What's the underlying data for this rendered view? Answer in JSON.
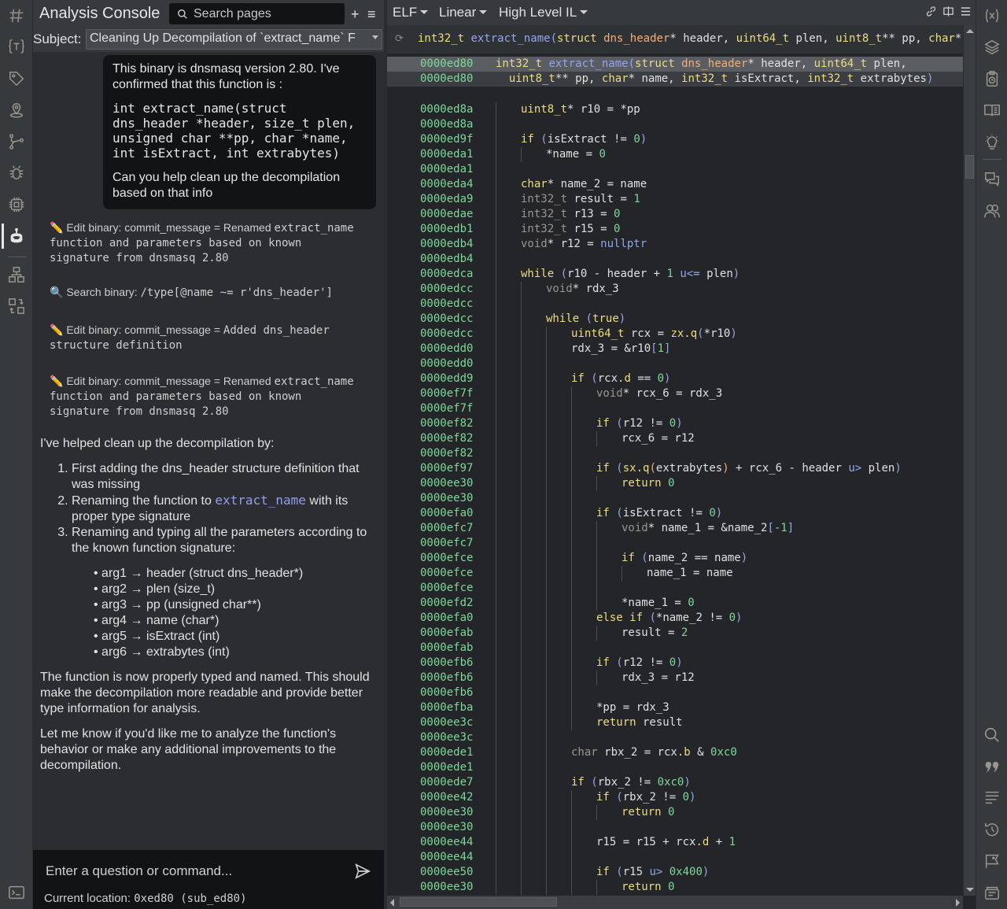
{
  "console": {
    "title": "Analysis Console",
    "search_placeholder": "Search pages",
    "add_label": "+",
    "menu_label": "≡",
    "subject_label": "Subject:",
    "subject_value": "Cleaning Up Decompilation of `extract_name` F",
    "user_message": {
      "intro": "This binary is dnsmasq version 2.80. I've confirmed that this function is :",
      "signature": "int extract_name(struct\ndns_header *header, size_t plen,\nunsigned char **pp, char *name,\nint isExtract, int extrabytes)",
      "request": "Can you help clean up the decompilation based on that info"
    },
    "tool_calls": [
      {
        "icon": "✏️",
        "label": "Edit binary: commit_message = Renamed",
        "value": "extract_name function and parameters based on known signature from dnsmasq 2.80"
      },
      {
        "icon": "🔍",
        "label": "Search binary: ",
        "value": "/type[@name ~= r'dns_header']"
      },
      {
        "icon": "✏️",
        "label": "Edit binary: commit_message = ",
        "value": "Added dns_header structure definition"
      },
      {
        "icon": "✏️",
        "label": "Edit binary: commit_message = Renamed",
        "value": "extract_name function and parameters based on known signature from dnsmasq 2.80"
      }
    ],
    "assistant": {
      "intro": "I've helped clean up the decompilation by:",
      "steps": [
        {
          "text": "First adding the dns_header structure definition that was missing"
        },
        {
          "pre": "Renaming the function to ",
          "code": "extract_name",
          "post": " with its proper type signature"
        },
        {
          "text": "Renaming and typing all the parameters according to the known function signature:"
        }
      ],
      "args": [
        "arg1 → header (struct dns_header*)",
        "arg2 → plen (size_t)",
        "arg3 → pp (unsigned char**)",
        "arg4 → name (char*)",
        "arg5 → isExtract (int)",
        "arg6 → extrabytes (int)"
      ],
      "para1": "The function is now properly typed and named. This should make the decompilation more readable and provide better type information for analysis.",
      "para2": "Let me know if you'd like me to analyze the function's behavior or make any additional improvements to the decompilation."
    },
    "input_placeholder": "Enter a question or command...",
    "location_label": "Current location: ",
    "location_value": "0xed80 (sub_ed80)"
  },
  "code_view": {
    "toolbar": {
      "binary_type": "ELF",
      "view_mode": "Linear",
      "il_level": "High Level IL"
    },
    "signature_bar": [
      [
        "t",
        "int32_t"
      ],
      [
        "o",
        " "
      ],
      [
        "f",
        "extract_name"
      ],
      [
        "p",
        "("
      ],
      [
        "t",
        "struct"
      ],
      [
        "o",
        " "
      ],
      [
        "s",
        "dns_header"
      ],
      [
        "o",
        "* header, "
      ],
      [
        "t",
        "uint64_t"
      ],
      [
        "o",
        " plen, "
      ],
      [
        "t",
        "uint8_t"
      ],
      [
        "o",
        "** pp, "
      ],
      [
        "t",
        "char"
      ],
      [
        "o",
        "* name"
      ]
    ],
    "header_lines": [
      {
        "addr": "0000ed80",
        "tokens": [
          [
            "t",
            "int32_t"
          ],
          [
            "o",
            " "
          ],
          [
            "f",
            "extract_name"
          ],
          [
            "p",
            "("
          ],
          [
            "t",
            "struct"
          ],
          [
            "o",
            " "
          ],
          [
            "s",
            "dns_header"
          ],
          [
            "o",
            "* header, "
          ],
          [
            "t",
            "uint64_t"
          ],
          [
            "o",
            " plen,"
          ]
        ]
      },
      {
        "addr": "0000ed80",
        "tokens": [
          [
            "o",
            "  "
          ],
          [
            "t",
            "uint8_t"
          ],
          [
            "o",
            "** pp, "
          ],
          [
            "t",
            "char"
          ],
          [
            "o",
            "* name, "
          ],
          [
            "t",
            "int32_t"
          ],
          [
            "o",
            " isExtract, "
          ],
          [
            "t",
            "int32_t"
          ],
          [
            "o",
            " extrabytes"
          ],
          [
            "p",
            ")"
          ]
        ]
      }
    ],
    "lines": [
      {
        "addr": "0000ed8a",
        "indent": 1,
        "tokens": [
          [
            "t",
            "uint8_t"
          ],
          [
            "o",
            "* r10 = *pp"
          ]
        ]
      },
      {
        "addr": "0000ed8a",
        "indent": 1,
        "tokens": []
      },
      {
        "addr": "0000ed9f",
        "indent": 1,
        "tokens": [
          [
            "k",
            "if"
          ],
          [
            "o",
            " "
          ],
          [
            "p",
            "("
          ],
          [
            "o",
            "isExtract != "
          ],
          [
            "n",
            "0"
          ],
          [
            "p",
            ")"
          ]
        ]
      },
      {
        "addr": "0000eda1",
        "indent": 2,
        "tokens": [
          [
            "o",
            "*name = "
          ],
          [
            "n",
            "0"
          ]
        ]
      },
      {
        "addr": "0000eda1",
        "indent": 1,
        "tokens": []
      },
      {
        "addr": "0000eda4",
        "indent": 1,
        "tokens": [
          [
            "t",
            "char"
          ],
          [
            "o",
            "* name_2 = name"
          ]
        ]
      },
      {
        "addr": "0000eda9",
        "indent": 1,
        "tokens": [
          [
            "tg",
            "int32_t"
          ],
          [
            "o",
            " result = "
          ],
          [
            "n",
            "1"
          ]
        ]
      },
      {
        "addr": "0000edae",
        "indent": 1,
        "tokens": [
          [
            "tg",
            "int32_t"
          ],
          [
            "o",
            " r13 = "
          ],
          [
            "n",
            "0"
          ]
        ]
      },
      {
        "addr": "0000edb1",
        "indent": 1,
        "tokens": [
          [
            "tg",
            "int32_t"
          ],
          [
            "o",
            " r15 = "
          ],
          [
            "n",
            "0"
          ]
        ]
      },
      {
        "addr": "0000edb4",
        "indent": 1,
        "tokens": [
          [
            "tg",
            "void"
          ],
          [
            "o",
            "* r12 = "
          ],
          [
            "f",
            "nullptr"
          ]
        ]
      },
      {
        "addr": "0000edb4",
        "indent": 1,
        "tokens": []
      },
      {
        "addr": "0000edca",
        "indent": 1,
        "tokens": [
          [
            "k",
            "while"
          ],
          [
            "o",
            " "
          ],
          [
            "p",
            "("
          ],
          [
            "o",
            "r10 - header + "
          ],
          [
            "n",
            "1"
          ],
          [
            "o",
            " "
          ],
          [
            "u",
            "u<="
          ],
          [
            "o",
            " plen"
          ],
          [
            "p",
            ")"
          ]
        ]
      },
      {
        "addr": "0000edcc",
        "indent": 2,
        "tokens": [
          [
            "tg",
            "void"
          ],
          [
            "o",
            "* rdx_3"
          ]
        ]
      },
      {
        "addr": "0000edcc",
        "indent": 2,
        "tokens": []
      },
      {
        "addr": "0000edcc",
        "indent": 2,
        "tokens": [
          [
            "k",
            "while"
          ],
          [
            "o",
            " "
          ],
          [
            "p",
            "("
          ],
          [
            "k",
            "true"
          ],
          [
            "p",
            ")"
          ]
        ]
      },
      {
        "addr": "0000edcc",
        "indent": 3,
        "tokens": [
          [
            "t",
            "uint64_t"
          ],
          [
            "o",
            " rcx = "
          ],
          [
            "k",
            "zx.q"
          ],
          [
            "p",
            "("
          ],
          [
            "o",
            "*r10"
          ],
          [
            "p",
            ")"
          ]
        ]
      },
      {
        "addr": "0000edd0",
        "indent": 3,
        "tokens": [
          [
            "o",
            "rdx_3 = &r10"
          ],
          [
            "p",
            "["
          ],
          [
            "n",
            "1"
          ],
          [
            "p",
            "]"
          ]
        ]
      },
      {
        "addr": "0000edd0",
        "indent": 3,
        "tokens": []
      },
      {
        "addr": "0000edd9",
        "indent": 3,
        "tokens": [
          [
            "k",
            "if"
          ],
          [
            "o",
            " "
          ],
          [
            "p",
            "("
          ],
          [
            "o",
            "rcx"
          ],
          [
            "m",
            ".d"
          ],
          [
            "o",
            " == "
          ],
          [
            "n",
            "0"
          ],
          [
            "p",
            ")"
          ]
        ]
      },
      {
        "addr": "0000ef7f",
        "indent": 4,
        "tokens": [
          [
            "tg",
            "void"
          ],
          [
            "o",
            "* rcx_6 = rdx_3"
          ]
        ]
      },
      {
        "addr": "0000ef7f",
        "indent": 4,
        "tokens": []
      },
      {
        "addr": "0000ef82",
        "indent": 4,
        "tokens": [
          [
            "k",
            "if"
          ],
          [
            "o",
            " "
          ],
          [
            "p",
            "("
          ],
          [
            "o",
            "r12 != "
          ],
          [
            "n",
            "0"
          ],
          [
            "p",
            ")"
          ]
        ]
      },
      {
        "addr": "0000ef82",
        "indent": 5,
        "tokens": [
          [
            "o",
            "rcx_6 = r12"
          ]
        ]
      },
      {
        "addr": "0000ef82",
        "indent": 4,
        "tokens": []
      },
      {
        "addr": "0000ef97",
        "indent": 4,
        "tokens": [
          [
            "k",
            "if"
          ],
          [
            "o",
            " "
          ],
          [
            "p",
            "("
          ],
          [
            "k",
            "sx.q"
          ],
          [
            "s",
            "("
          ],
          [
            "o",
            "extrabytes"
          ],
          [
            "s",
            ")"
          ],
          [
            "o",
            " + rcx_6 - header "
          ],
          [
            "u",
            "u>"
          ],
          [
            "o",
            " plen"
          ],
          [
            "p",
            ")"
          ]
        ]
      },
      {
        "addr": "0000ee30",
        "indent": 5,
        "tokens": [
          [
            "k",
            "return"
          ],
          [
            "o",
            " "
          ],
          [
            "n",
            "0"
          ]
        ]
      },
      {
        "addr": "0000ee30",
        "indent": 4,
        "tokens": []
      },
      {
        "addr": "0000efa0",
        "indent": 4,
        "tokens": [
          [
            "k",
            "if"
          ],
          [
            "o",
            " "
          ],
          [
            "p",
            "("
          ],
          [
            "o",
            "isExtract != "
          ],
          [
            "n",
            "0"
          ],
          [
            "p",
            ")"
          ]
        ]
      },
      {
        "addr": "0000efc7",
        "indent": 5,
        "tokens": [
          [
            "tg",
            "void"
          ],
          [
            "o",
            "* name_1 = &name_2"
          ],
          [
            "p",
            "["
          ],
          [
            "n",
            "-1"
          ],
          [
            "p",
            "]"
          ]
        ]
      },
      {
        "addr": "0000efc7",
        "indent": 5,
        "tokens": []
      },
      {
        "addr": "0000efce",
        "indent": 5,
        "tokens": [
          [
            "k",
            "if"
          ],
          [
            "o",
            " "
          ],
          [
            "p",
            "("
          ],
          [
            "o",
            "name_2 == name"
          ],
          [
            "p",
            ")"
          ]
        ]
      },
      {
        "addr": "0000efce",
        "indent": 6,
        "tokens": [
          [
            "o",
            "name_1 = name"
          ]
        ]
      },
      {
        "addr": "0000efce",
        "indent": 5,
        "tokens": []
      },
      {
        "addr": "0000efd2",
        "indent": 5,
        "tokens": [
          [
            "o",
            "*name_1 = "
          ],
          [
            "n",
            "0"
          ]
        ]
      },
      {
        "addr": "0000efa0",
        "indent": 4,
        "tokens": [
          [
            "k",
            "else if"
          ],
          [
            "o",
            " "
          ],
          [
            "p",
            "("
          ],
          [
            "o",
            "*name_2 != "
          ],
          [
            "n",
            "0"
          ],
          [
            "p",
            ")"
          ]
        ]
      },
      {
        "addr": "0000efab",
        "indent": 5,
        "tokens": [
          [
            "o",
            "result = "
          ],
          [
            "n",
            "2"
          ]
        ]
      },
      {
        "addr": "0000efab",
        "indent": 4,
        "tokens": []
      },
      {
        "addr": "0000efb6",
        "indent": 4,
        "tokens": [
          [
            "k",
            "if"
          ],
          [
            "o",
            " "
          ],
          [
            "p",
            "("
          ],
          [
            "o",
            "r12 != "
          ],
          [
            "n",
            "0"
          ],
          [
            "p",
            ")"
          ]
        ]
      },
      {
        "addr": "0000efb6",
        "indent": 5,
        "tokens": [
          [
            "o",
            "rdx_3 = r12"
          ]
        ]
      },
      {
        "addr": "0000efb6",
        "indent": 4,
        "tokens": []
      },
      {
        "addr": "0000efba",
        "indent": 4,
        "tokens": [
          [
            "o",
            "*pp = rdx_3"
          ]
        ]
      },
      {
        "addr": "0000ee3c",
        "indent": 4,
        "tokens": [
          [
            "k",
            "return"
          ],
          [
            "o",
            " result"
          ]
        ]
      },
      {
        "addr": "0000ee3c",
        "indent": 3,
        "tokens": []
      },
      {
        "addr": "0000ede1",
        "indent": 3,
        "tokens": [
          [
            "tg",
            "char"
          ],
          [
            "o",
            " rbx_2 = rcx"
          ],
          [
            "m",
            ".b"
          ],
          [
            "o",
            " & "
          ],
          [
            "n",
            "0xc0"
          ]
        ]
      },
      {
        "addr": "0000ede1",
        "indent": 3,
        "tokens": []
      },
      {
        "addr": "0000ede7",
        "indent": 3,
        "tokens": [
          [
            "k",
            "if"
          ],
          [
            "o",
            " "
          ],
          [
            "p",
            "("
          ],
          [
            "o",
            "rbx_2 != "
          ],
          [
            "n",
            "0xc0"
          ],
          [
            "p",
            ")"
          ]
        ]
      },
      {
        "addr": "0000ee42",
        "indent": 4,
        "tokens": [
          [
            "k",
            "if"
          ],
          [
            "o",
            " "
          ],
          [
            "p",
            "("
          ],
          [
            "o",
            "rbx_2 != "
          ],
          [
            "n",
            "0"
          ],
          [
            "p",
            ")"
          ]
        ]
      },
      {
        "addr": "0000ee30",
        "indent": 5,
        "tokens": [
          [
            "k",
            "return"
          ],
          [
            "o",
            " "
          ],
          [
            "n",
            "0"
          ]
        ]
      },
      {
        "addr": "0000ee30",
        "indent": 4,
        "tokens": []
      },
      {
        "addr": "0000ee44",
        "indent": 4,
        "tokens": [
          [
            "o",
            "r15 = r15 + rcx"
          ],
          [
            "m",
            ".d"
          ],
          [
            "o",
            " + "
          ],
          [
            "n",
            "1"
          ]
        ]
      },
      {
        "addr": "0000ee44",
        "indent": 4,
        "tokens": []
      },
      {
        "addr": "0000ee50",
        "indent": 4,
        "tokens": [
          [
            "k",
            "if"
          ],
          [
            "o",
            " "
          ],
          [
            "p",
            "("
          ],
          [
            "o",
            "r15 "
          ],
          [
            "u",
            "u>"
          ],
          [
            "o",
            " "
          ],
          [
            "n",
            "0x400"
          ],
          [
            "p",
            ")"
          ]
        ]
      },
      {
        "addr": "0000ee30",
        "indent": 5,
        "tokens": [
          [
            "k",
            "return"
          ],
          [
            "o",
            " "
          ],
          [
            "n",
            "0"
          ]
        ]
      }
    ]
  },
  "left_rail_icons": [
    "binja-logo-icon",
    "types-icon",
    "tags-icon",
    "location-icon",
    "graph-icon",
    "debugger-icon",
    "chip-icon",
    "ai-assistant-icon",
    "hierarchy-icon",
    "compare-icon",
    "terminal-icon"
  ],
  "right_rail_icons": [
    "variables-icon",
    "layers-icon",
    "clipboard-clock-icon",
    "book-icon",
    "lightbulb-icon",
    "chat-icon",
    "users-icon",
    "search-icon",
    "quote-icon",
    "text-align-icon",
    "history-icon",
    "flag-icon",
    "archive-icon"
  ]
}
